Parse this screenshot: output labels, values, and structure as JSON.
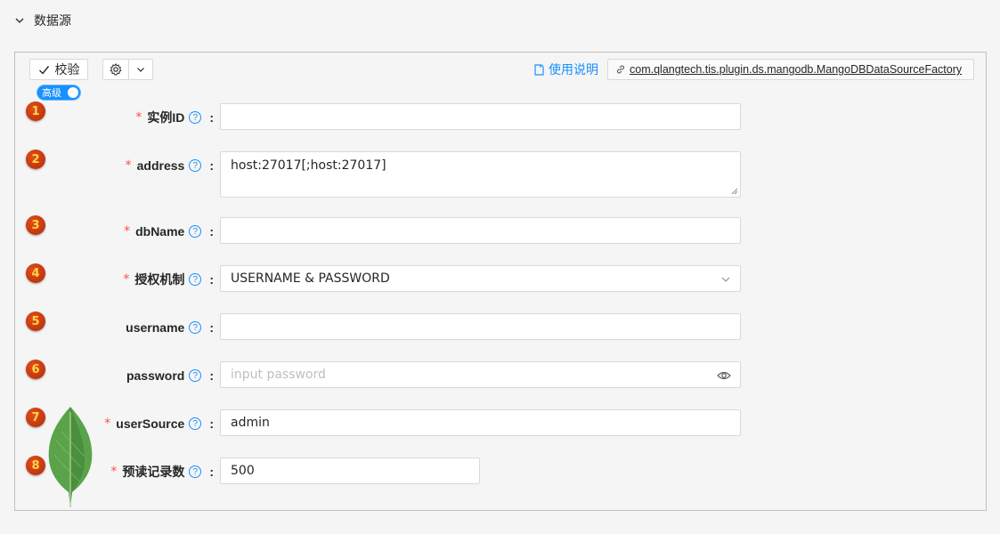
{
  "section": {
    "title": "数据源",
    "icon": "chevron-down-icon"
  },
  "toolbar": {
    "verify_label": "校验",
    "help_label": "使用说明",
    "class_name": "com.qlangtech.tis.plugin.ds.mangodb.MangoDBDataSourceFactory",
    "advanced_label": "高级"
  },
  "fields": [
    {
      "num": "1",
      "label": "实例ID",
      "required": "*",
      "value": "",
      "placeholder": ""
    },
    {
      "num": "2",
      "label": "address",
      "required": "*",
      "value": "host:27017[;host:27017]",
      "placeholder": ""
    },
    {
      "num": "3",
      "label": "dbName",
      "required": "*",
      "value": "",
      "placeholder": ""
    },
    {
      "num": "4",
      "label": "授权机制",
      "required": "*",
      "value": "USERNAME & PASSWORD",
      "placeholder": ""
    },
    {
      "num": "5",
      "label": "username",
      "required": "",
      "value": "",
      "placeholder": ""
    },
    {
      "num": "6",
      "label": "password",
      "required": "",
      "value": "",
      "placeholder": "input password"
    },
    {
      "num": "7",
      "label": "userSource",
      "required": "*",
      "value": "admin",
      "placeholder": ""
    },
    {
      "num": "8",
      "label": "预读记录数",
      "required": "*",
      "value": "500",
      "placeholder": ""
    }
  ],
  "colors": {
    "accent": "#1890ff",
    "required": "#ff4d4f",
    "badge": "#c1350b",
    "leaf": "#5aa34a"
  }
}
